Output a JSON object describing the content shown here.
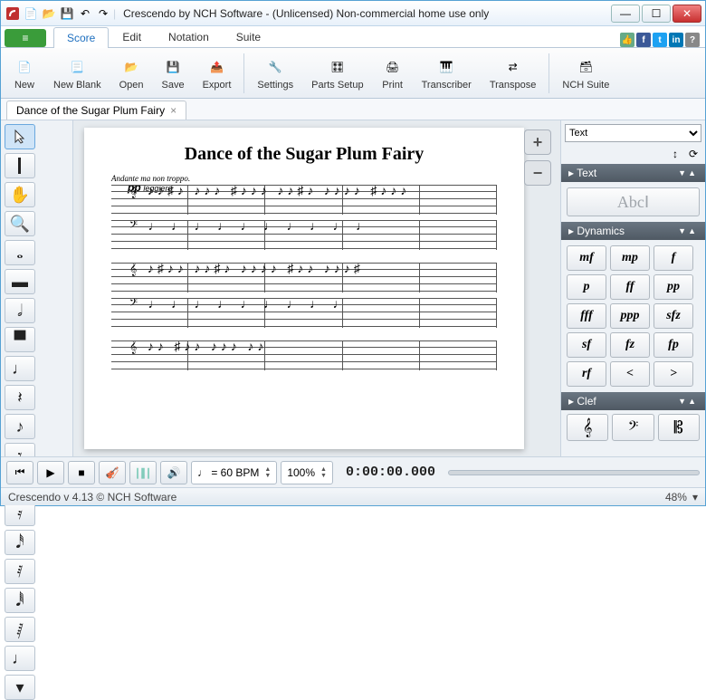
{
  "window": {
    "title": "Crescendo by NCH Software - (Unlicensed) Non-commercial home use only"
  },
  "tabs": {
    "score": "Score",
    "edit": "Edit",
    "notation": "Notation",
    "suite": "Suite"
  },
  "ribbon": {
    "new": "New",
    "newblank": "New Blank",
    "open": "Open",
    "save": "Save",
    "export": "Export",
    "settings": "Settings",
    "parts": "Parts Setup",
    "print": "Print",
    "transcriber": "Transcriber",
    "transpose": "Transpose",
    "nchsuite": "NCH Suite"
  },
  "doc": {
    "tab_title": "Dance of the Sugar Plum Fairy"
  },
  "score": {
    "title": "Dance of the Sugar Plum Fairy",
    "tempo_marking": "Andante ma non troppo.",
    "dynamic": "pp",
    "expression": "leggiero"
  },
  "rightpanel": {
    "selector": "Text",
    "text_head": "Text",
    "text_sample": "AbcⅠ",
    "dynamics_head": "Dynamics",
    "dynamics": [
      "mf",
      "mp",
      "f",
      "p",
      "ff",
      "pp",
      "fff",
      "ppp",
      "sfz",
      "sf",
      "fz",
      "fp",
      "rf",
      "<",
      ">"
    ],
    "clef_head": "Clef"
  },
  "playback": {
    "tempo_display": "♩ = 60 BPM",
    "zoom_display": "100%",
    "timecode": "0:00:00.000"
  },
  "status": {
    "version": "Crescendo v 4.13 © NCH Software",
    "zoom": "48%"
  }
}
